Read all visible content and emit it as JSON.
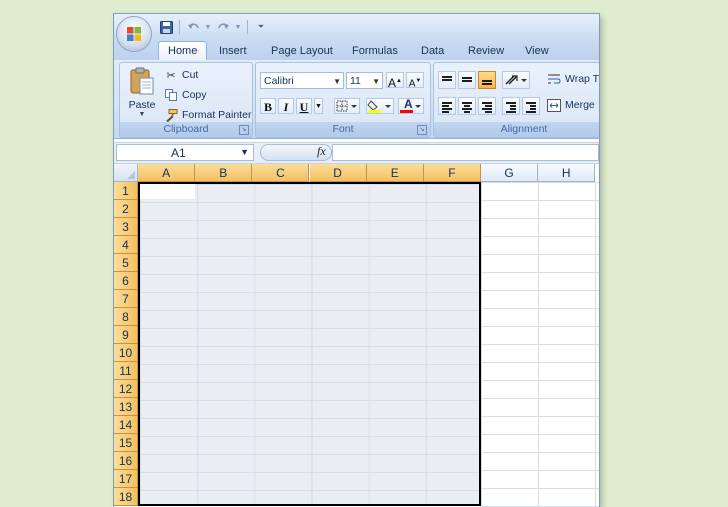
{
  "quick_access": {
    "save": "save-icon",
    "undo": "undo-icon",
    "redo": "redo-icon",
    "customize": "customize-icon"
  },
  "tabs": [
    "Home",
    "Insert",
    "Page Layout",
    "Formulas",
    "Data",
    "Review",
    "View"
  ],
  "active_tab": "Home",
  "clipboard": {
    "paste": "Paste",
    "cut": "Cut",
    "copy": "Copy",
    "format_painter": "Format Painter",
    "label": "Clipboard"
  },
  "font": {
    "name": "Calibri",
    "size": "11",
    "grow": "A",
    "shrink": "A",
    "bold": "B",
    "italic": "I",
    "underline": "U",
    "font_color_letter": "A",
    "label": "Font"
  },
  "alignment": {
    "wrap_text": "Wrap T",
    "merge": "Merge",
    "label": "Alignment"
  },
  "formula_bar": {
    "name_box": "A1",
    "fx": "fx",
    "value": ""
  },
  "grid": {
    "columns": [
      "A",
      "B",
      "C",
      "D",
      "E",
      "F",
      "G",
      "H"
    ],
    "selected_columns": [
      "A",
      "B",
      "C",
      "D",
      "E",
      "F"
    ],
    "rows": [
      "1",
      "2",
      "3",
      "4",
      "5",
      "6",
      "7",
      "8",
      "9",
      "10",
      "11",
      "12",
      "13",
      "14",
      "15",
      "16",
      "17",
      "18"
    ],
    "active_cell": "A1"
  },
  "colors": {
    "background": "#dfeccf",
    "header_selected": "#f4c060",
    "selection_fill": "#eaedf4",
    "ribbon": "#d3e2f5"
  }
}
